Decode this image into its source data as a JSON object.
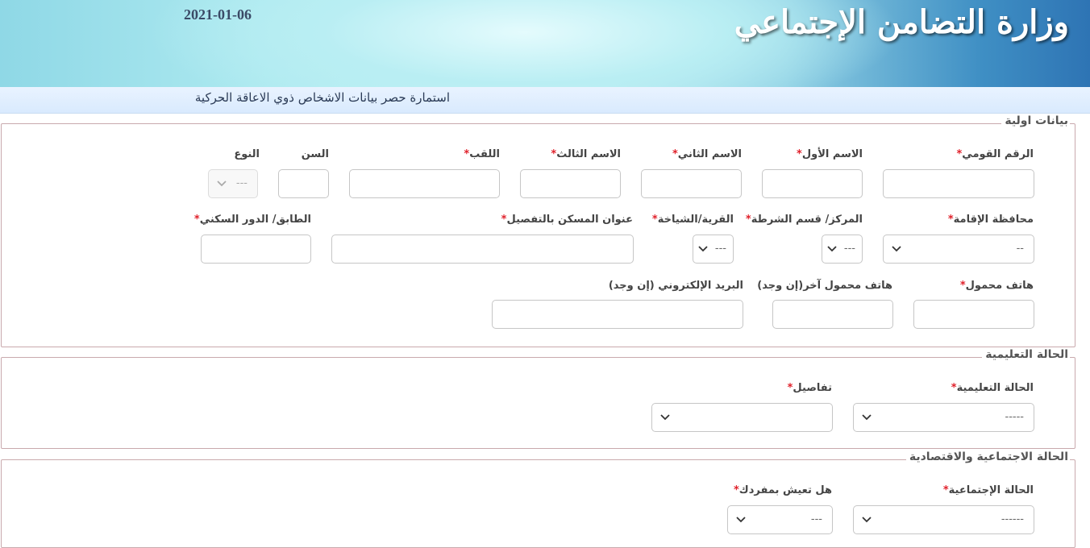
{
  "header": {
    "ministry_title": "وزارة التضامن الإجتماعي",
    "date": "2021-01-06",
    "form_title": "استمارة حصر بيانات الاشخاص ذوي الاعاقة الحركية"
  },
  "required_mark": "*",
  "sections": {
    "basic": {
      "legend": "بيانات اولية",
      "fields": {
        "national_id": {
          "label": "الرقم القومي",
          "value": ""
        },
        "first_name": {
          "label": "الاسم الأول",
          "value": ""
        },
        "second_name": {
          "label": "الاسم الثاني",
          "value": ""
        },
        "third_name": {
          "label": "الاسم الثالث",
          "value": ""
        },
        "surname": {
          "label": "اللقب",
          "value": ""
        },
        "age": {
          "label": "السن",
          "value": ""
        },
        "gender": {
          "label": "النوع",
          "selected": "---"
        },
        "governorate": {
          "label": "محافظة الإقامة",
          "selected": "--"
        },
        "district": {
          "label": "المركز/ قسم الشرطة",
          "selected": "---"
        },
        "village": {
          "label": "القرية/الشياخة",
          "selected": "---"
        },
        "address": {
          "label": "عنوان المسكن بالتفصيل",
          "value": ""
        },
        "floor": {
          "label": "الطابق/ الدور السكني",
          "value": ""
        },
        "mobile": {
          "label": "هاتف محمول",
          "value": ""
        },
        "other_mobile": {
          "label": "هاتف محمول آخر(إن وجد)",
          "value": ""
        },
        "email": {
          "label": "البريد الإلكتروني (إن وجد)",
          "value": ""
        }
      }
    },
    "education": {
      "legend": "الحالة التعليمية",
      "fields": {
        "status": {
          "label": "الحالة التعليمية",
          "selected": "-----"
        },
        "details": {
          "label": "تفاصيل",
          "selected": ""
        }
      }
    },
    "social": {
      "legend": "الحالة الاجتماعية والاقتصادية",
      "fields": {
        "marital": {
          "label": "الحالة الإجتماعية",
          "selected": "------"
        },
        "lives_alone": {
          "label": "هل تعيش بمفردك",
          "selected": "---"
        }
      }
    }
  },
  "colors": {
    "required": "#e0202a",
    "section_border": "#c9a9ad",
    "banner_blue": "#2e74b4"
  },
  "icons": [
    "chevron-down-icon"
  ]
}
